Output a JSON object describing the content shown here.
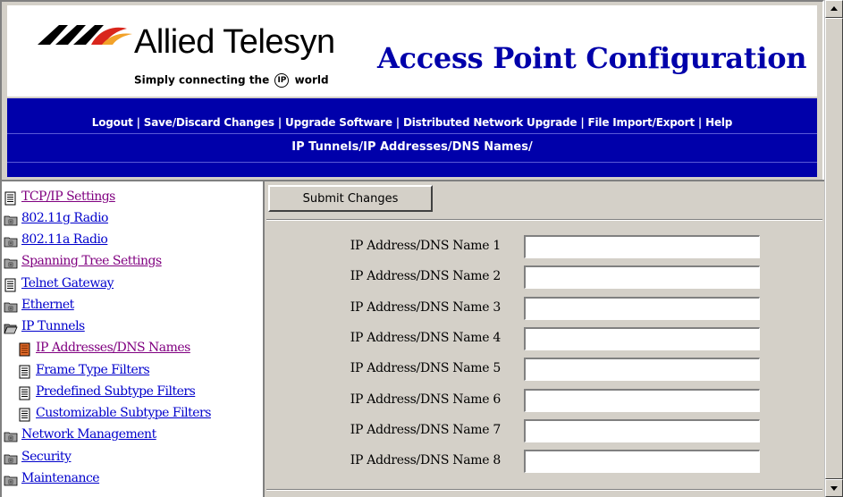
{
  "header": {
    "brand_name": "Allied Telesyn",
    "tagline_pre": "Simply connecting the",
    "tagline_ip": "IP",
    "tagline_post": "world",
    "page_title": "Access Point Configuration"
  },
  "nav": {
    "links": [
      {
        "label": "Logout"
      },
      {
        "label": "Save/Discard Changes"
      },
      {
        "label": "Upgrade Software"
      },
      {
        "label": "Distributed Network Upgrade"
      },
      {
        "label": "File Import/Export"
      },
      {
        "label": "Help"
      }
    ],
    "separator": "|",
    "breadcrumb": "IP Tunnels/IP Addresses/DNS Names/"
  },
  "sidebar": {
    "items": [
      {
        "label": "TCP/IP Settings",
        "icon": "document-icon"
      },
      {
        "label": "802.11g Radio",
        "icon": "folder-closed-icon"
      },
      {
        "label": "802.11a Radio",
        "icon": "folder-closed-icon"
      },
      {
        "label": "Spanning Tree Settings",
        "icon": "folder-closed-icon"
      },
      {
        "label": "Telnet Gateway",
        "icon": "document-icon"
      },
      {
        "label": "Ethernet",
        "icon": "folder-closed-icon"
      },
      {
        "label": "IP Tunnels",
        "icon": "folder-open-icon"
      },
      {
        "label": "IP Addresses/DNS Names",
        "icon": "document-selected-icon"
      },
      {
        "label": "Frame Type Filters",
        "icon": "document-icon"
      },
      {
        "label": "Predefined Subtype Filters",
        "icon": "document-icon"
      },
      {
        "label": "Customizable Subtype Filters",
        "icon": "document-icon"
      },
      {
        "label": "Network Management",
        "icon": "folder-closed-icon"
      },
      {
        "label": "Security",
        "icon": "folder-closed-icon"
      },
      {
        "label": "Maintenance",
        "icon": "folder-closed-icon"
      }
    ]
  },
  "main": {
    "submit_label": "Submit Changes",
    "fields": [
      {
        "label": "IP Address/DNS Name 1",
        "value": ""
      },
      {
        "label": "IP Address/DNS Name 2",
        "value": ""
      },
      {
        "label": "IP Address/DNS Name 3",
        "value": ""
      },
      {
        "label": "IP Address/DNS Name 4",
        "value": ""
      },
      {
        "label": "IP Address/DNS Name 5",
        "value": ""
      },
      {
        "label": "IP Address/DNS Name 6",
        "value": ""
      },
      {
        "label": "IP Address/DNS Name 7",
        "value": ""
      },
      {
        "label": "IP Address/DNS Name 8",
        "value": ""
      }
    ]
  },
  "colors": {
    "nav_band": "#0000aa",
    "title": "#0000aa",
    "link": "#0000cc",
    "link_visited": "#800080",
    "frame_bg": "#d4d0c8"
  }
}
